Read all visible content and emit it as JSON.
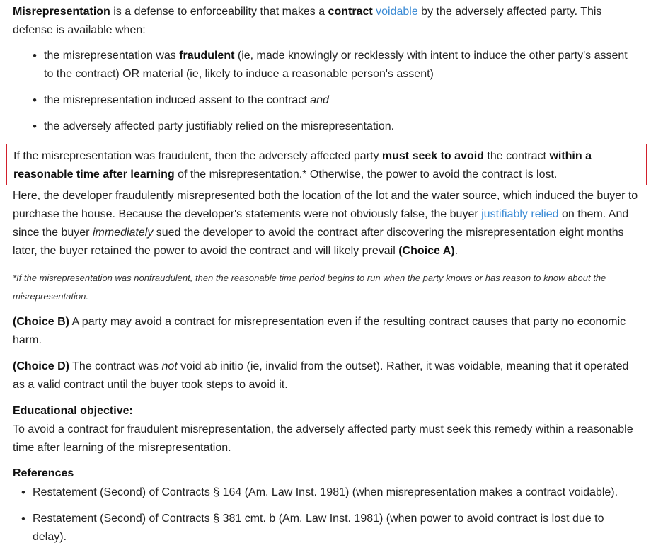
{
  "intro": {
    "t1": "Misrepresentation",
    "t2": " is a defense to enforceability that makes a ",
    "t3": "contract",
    "t4": " ",
    "t5": "voidable",
    "t6": " by the adversely affected party.  This defense is available when:"
  },
  "bullets": [
    {
      "a": "the misrepresentation was ",
      "b": "fraudulent",
      "c": " (ie, made knowingly or recklessly with intent to induce the other party's assent to the contract) OR material (ie, likely to induce a reasonable person's assent)"
    },
    {
      "a": "the misrepresentation induced assent to the contract ",
      "b": "and"
    },
    {
      "a": "the adversely affected party justifiably relied on the misrepresentation."
    }
  ],
  "highlight": {
    "a": "If the misrepresentation was fraudulent, then the adversely affected party ",
    "b": "must seek to avoid",
    "c": " the contract ",
    "d": "within a reasonable time after learning",
    "e": " of the misrepresentation.*  Otherwise, the power to avoid the contract is lost."
  },
  "analysis": {
    "a": "Here, the developer fraudulently misrepresented both the location of the lot and the water source, which induced the buyer to purchase the house.  Because the developer's statements were not obviously false, the buyer ",
    "link": "justifiably relied",
    "b": " on them.  And since the buyer ",
    "c": "immediately",
    "d": " sued the developer to avoid the contract after discovering the misrepresentation eight months later, the buyer retained the power to avoid the contract and will likely prevail ",
    "e": "(Choice A)",
    "f": "."
  },
  "footnote": "*If the misrepresentation was nonfraudulent, then the reasonable time period begins to run when the party knows or has reason to know about the misrepresentation.",
  "choice_b": {
    "label": "(Choice B)",
    "text": "  A party may avoid a contract for misrepresentation even if the resulting contract causes that party no economic harm."
  },
  "choice_d": {
    "label": "(Choice D)",
    "a": "  The contract was ",
    "b": "not",
    "c": " void ab initio (ie, invalid from the outset).  Rather, it was voidable, meaning that it operated as a valid contract until the buyer took steps to avoid it."
  },
  "educational": {
    "title": "Educational objective:",
    "text": "To avoid a contract for fraudulent misrepresentation, the adversely affected party must seek this remedy within a reasonable time after learning of the misrepresentation."
  },
  "references": {
    "title": "References",
    "items": [
      "Restatement (Second) of Contracts § 164 (Am. Law Inst. 1981) (when misrepresentation makes a contract voidable).",
      "Restatement (Second) of Contracts § 381 cmt. b (Am. Law Inst. 1981) (when power to avoid contract is lost due to delay)."
    ]
  },
  "colors": {
    "link": "#3a8ad4",
    "highlight_border": "#d21f2b",
    "text": "#222222"
  }
}
